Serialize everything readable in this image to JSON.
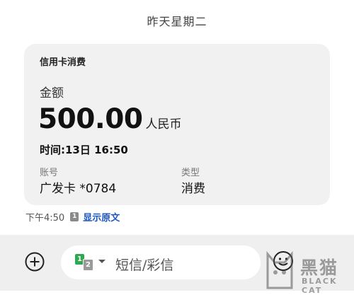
{
  "date_header": "昨天星期二",
  "message": {
    "card_title": "信用卡消费",
    "amount_label": "金额",
    "amount_value": "500.00",
    "amount_currency": "人民币",
    "time_line": "时间:13日 16:50",
    "account_label": "账号",
    "account_value": "广发卡 *0784",
    "type_label": "类型",
    "type_value": "消费"
  },
  "meta": {
    "time": "下午4:50",
    "sim_number": "1",
    "show_original": "显示原文"
  },
  "composer": {
    "sim_primary": "1",
    "sim_secondary": "2",
    "placeholder": "短信/彩信"
  },
  "watermark": {
    "cn": "黑猫",
    "en": "BLACK CAT"
  },
  "colors": {
    "card_background": "#f1f1f1",
    "link": "#1a56c4",
    "sim1_green": "#2fa84f",
    "bottom_bar": "#efefef"
  },
  "icons": {
    "add": "add-circle-icon",
    "emoji": "emoji-icon",
    "chevron": "chevron-down-icon"
  }
}
